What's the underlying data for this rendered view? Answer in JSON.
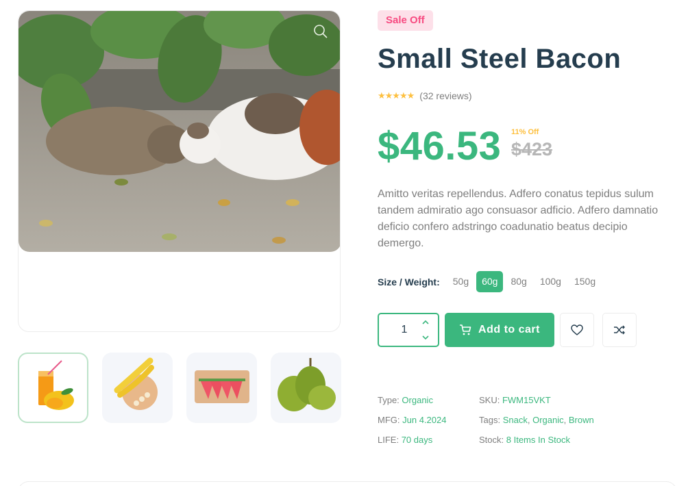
{
  "gallery": {
    "main_image_alt": "",
    "thumbnails": [
      {
        "name": "juice-mango"
      },
      {
        "name": "bananas"
      },
      {
        "name": "watermelon"
      },
      {
        "name": "durian"
      }
    ],
    "active_thumbnail": 0
  },
  "product": {
    "badge": "Sale Off",
    "title": "Small Steel Bacon",
    "rating_stars": "★★★★★",
    "reviews": "(32 reviews)",
    "price": "$46.53",
    "discount": "11% Off",
    "old_price": "$423",
    "description": "Amitto veritas repellendus. Adfero conatus tepidus sulum tandem admiratio ago consuasor adficio. Adfero damnatio deficio confero adstringo coadunatio beatus decipio demergo."
  },
  "sizes": {
    "label": "Size / Weight:",
    "options": [
      "50g",
      "60g",
      "80g",
      "100g",
      "150g"
    ],
    "selected": "60g"
  },
  "cart": {
    "quantity": "1",
    "add_label": "Add to cart"
  },
  "meta": {
    "type_label": "Type:",
    "type_value": "Organic",
    "mfg_label": "MFG:",
    "mfg_value": "Jun 4.2024",
    "life_label": "LIFE:",
    "life_value": "70 days",
    "sku_label": "SKU:",
    "sku_value": "FWM15VKT",
    "tags_label": "Tags:",
    "tags": [
      "Snack",
      "Organic",
      "Brown"
    ],
    "stock_label": "Stock:",
    "stock_value": "8 Items In Stock"
  },
  "colors": {
    "accent": "#3bb77e",
    "heading": "#253d4e",
    "muted": "#7e7e7e",
    "badge_bg": "#fde0e9",
    "badge_text": "#f74b81",
    "star": "#fdc040"
  }
}
